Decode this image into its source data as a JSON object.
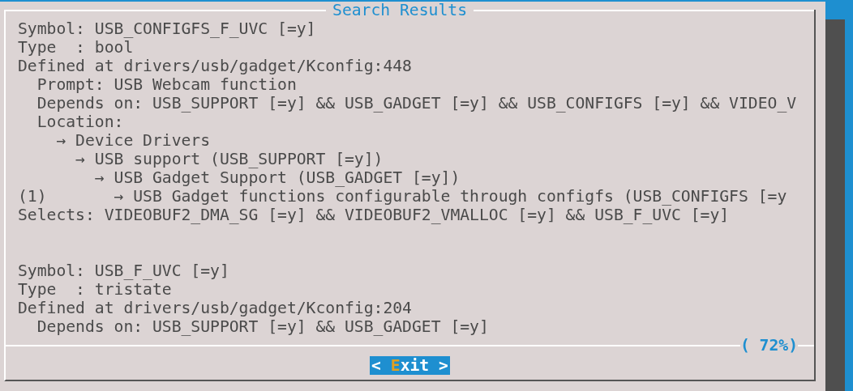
{
  "dialog": {
    "title": "Search Results",
    "blocks": [
      {
        "lines": [
          "Symbol: USB_CONFIGFS_F_UVC [=y]",
          "Type  : bool",
          "Defined at drivers/usb/gadget/Kconfig:448",
          "  Prompt: USB Webcam function",
          "  Depends on: USB_SUPPORT [=y] && USB_GADGET [=y] && USB_CONFIGFS [=y] && VIDEO_V",
          "  Location:",
          "    → Device Drivers",
          "      → USB support (USB_SUPPORT [=y])",
          "        → USB Gadget Support (USB_GADGET [=y])",
          "(1)       → USB Gadget functions configurable through configfs (USB_CONFIGFS [=y",
          "Selects: VIDEOBUF2_DMA_SG [=y] && VIDEOBUF2_VMALLOC [=y] && USB_F_UVC [=y]"
        ]
      },
      {
        "lines": [
          "Symbol: USB_F_UVC [=y]",
          "Type  : tristate",
          "Defined at drivers/usb/gadget/Kconfig:204",
          "  Depends on: USB_SUPPORT [=y] && USB_GADGET [=y]"
        ]
      }
    ],
    "progress": "( 72%)",
    "buttons": [
      {
        "before": "< ",
        "hotkey": "E",
        "after": "xit >",
        "selected": true
      }
    ]
  }
}
